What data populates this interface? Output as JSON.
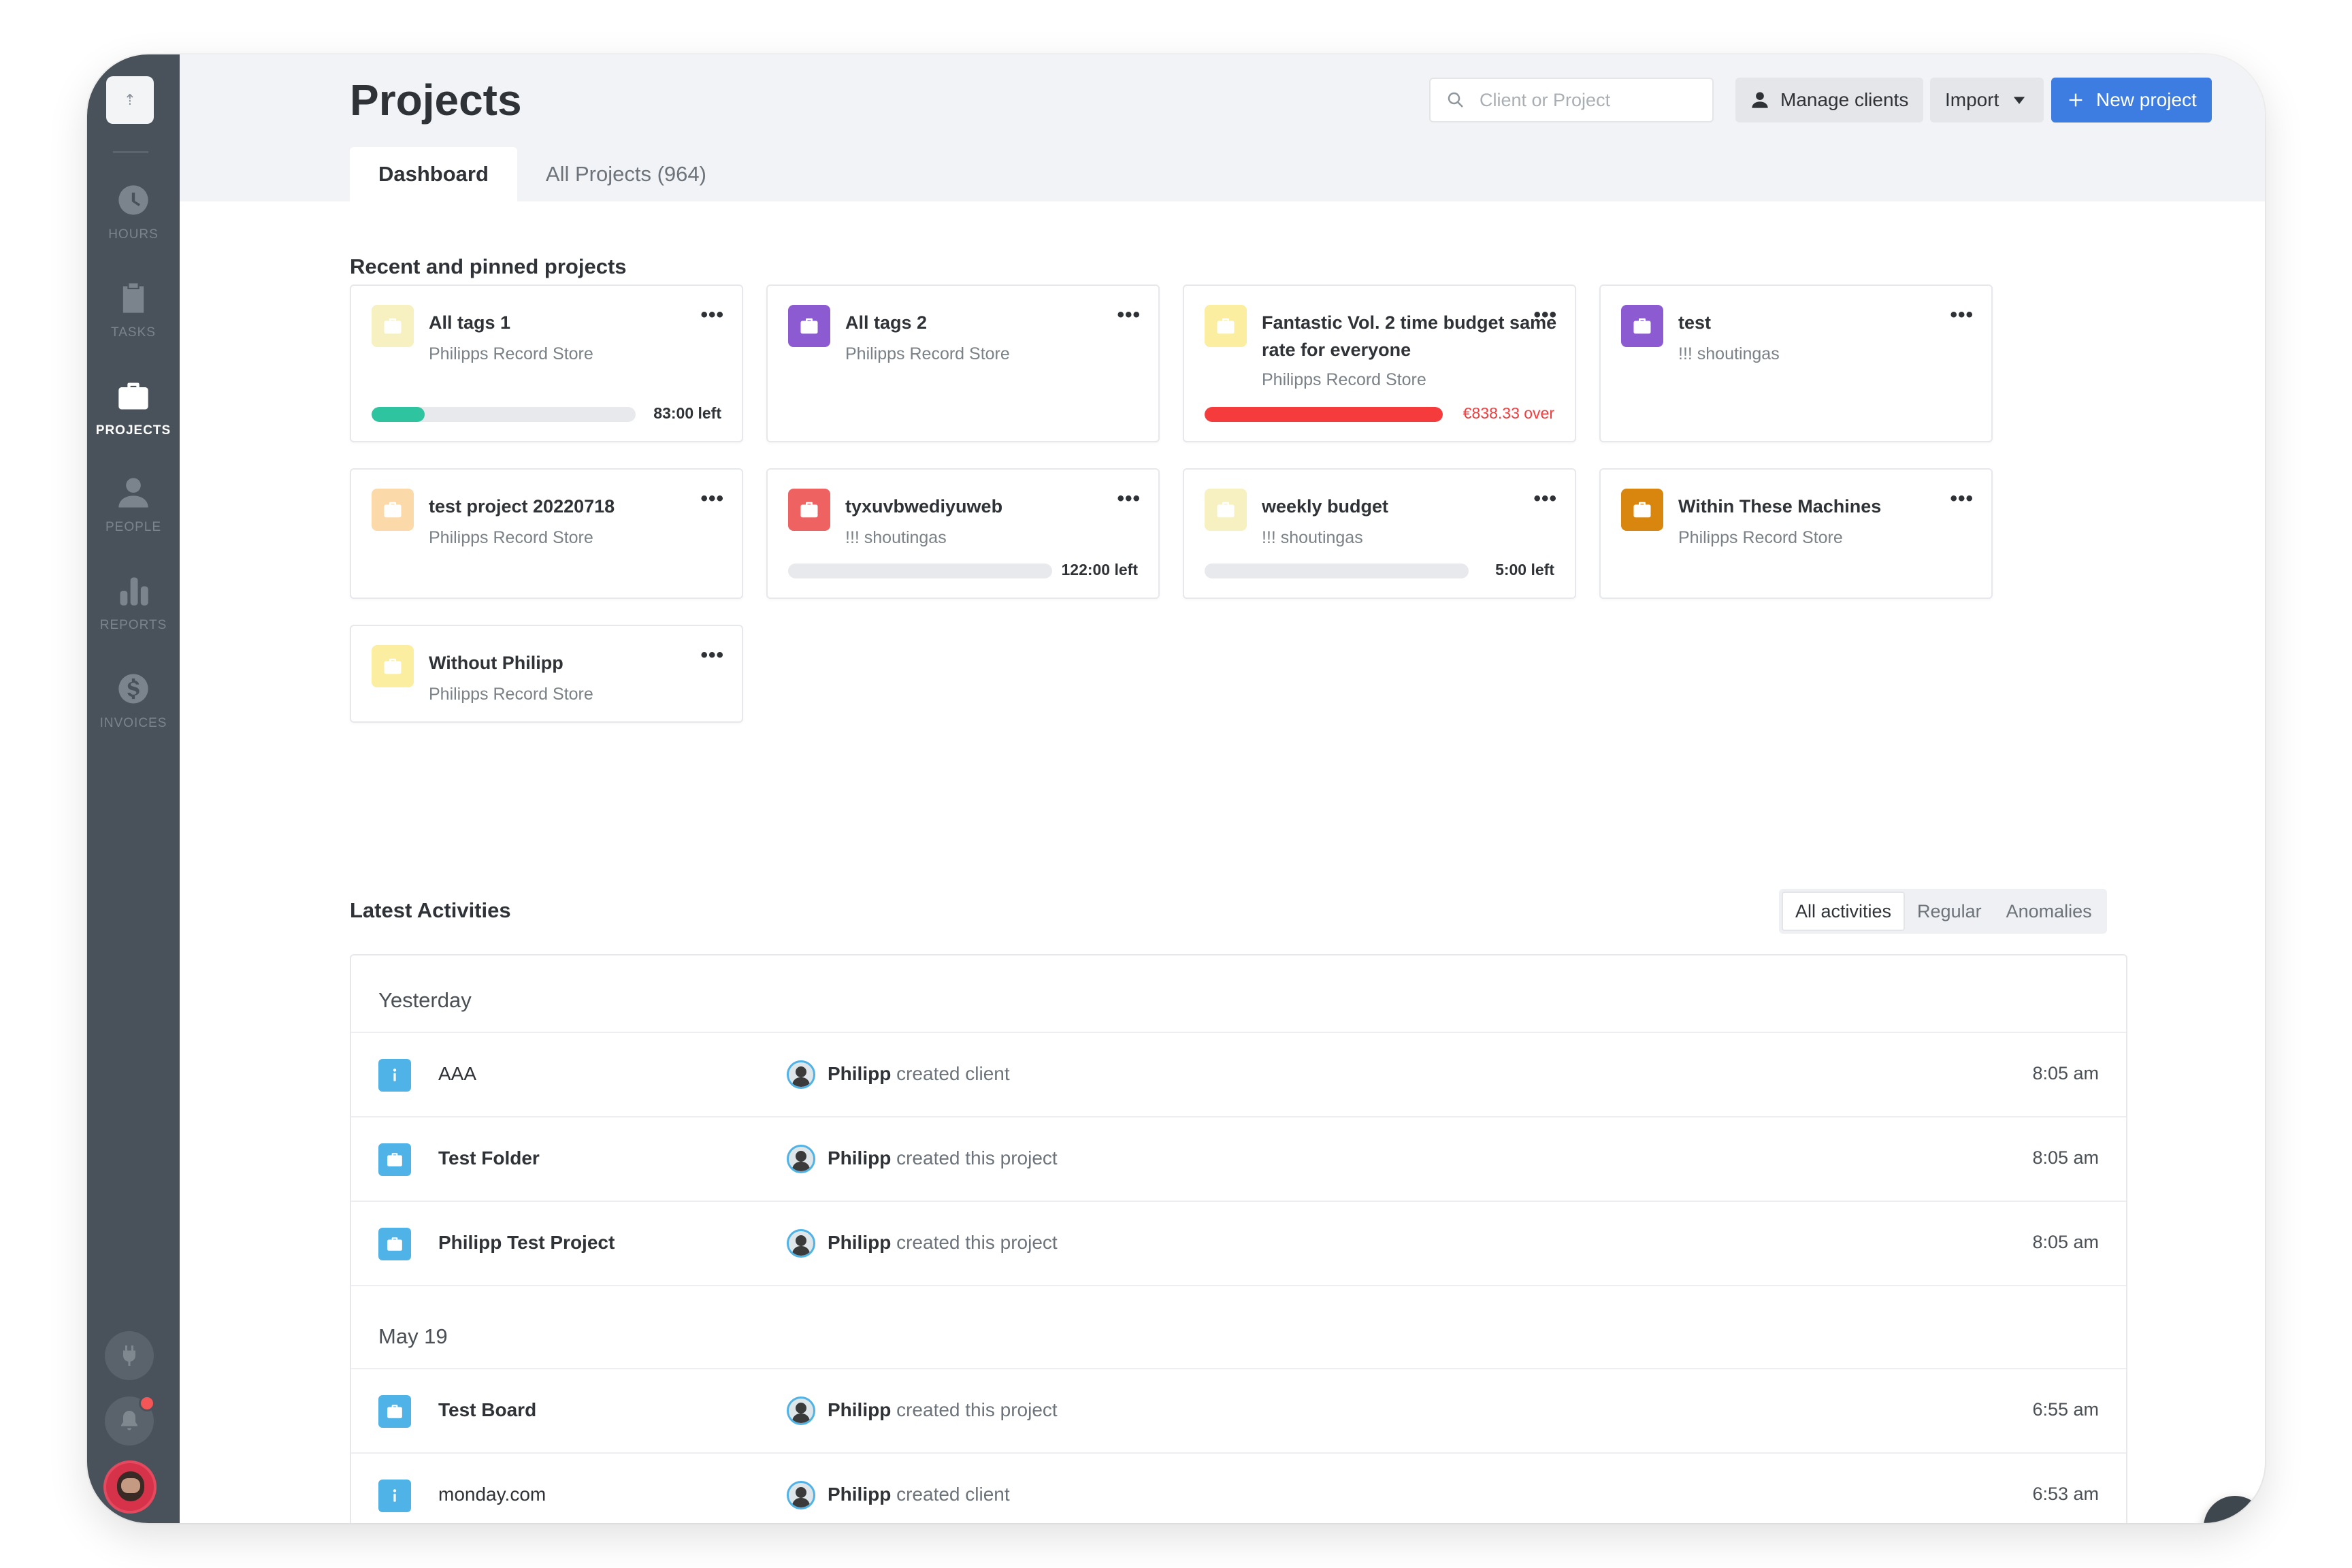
{
  "sidebar": {
    "nav": [
      {
        "id": "hours",
        "label": "HOURS",
        "icon": "clock-icon"
      },
      {
        "id": "tasks",
        "label": "TASKS",
        "icon": "clipboard-check-icon"
      },
      {
        "id": "projects",
        "label": "PROJECTS",
        "icon": "briefcase-icon",
        "active": true
      },
      {
        "id": "people",
        "label": "PEOPLE",
        "icon": "person-icon"
      },
      {
        "id": "reports",
        "label": "REPORTS",
        "icon": "bar-chart-icon"
      },
      {
        "id": "invoices",
        "label": "INVOICES",
        "icon": "dollar-icon"
      }
    ]
  },
  "header": {
    "title": "Projects",
    "search_placeholder": "Client or Project",
    "manage_clients_label": "Manage clients",
    "import_label": "Import",
    "new_project_label": "New project",
    "tabs": [
      {
        "label": "Dashboard",
        "active": true
      },
      {
        "label": "All Projects (964)",
        "active": false
      }
    ]
  },
  "recent": {
    "title": "Recent and pinned projects",
    "cards": [
      {
        "title": "All tags 1",
        "client": "Philipps Record Store",
        "color": "#f7f0c0",
        "budget_fraction": 0.2,
        "bar_color": "#2ec4a0",
        "budget_text": "83:00 left"
      },
      {
        "title": "All tags 2",
        "client": "Philipps Record Store",
        "color": "#8d5bd1"
      },
      {
        "title": "Fantastic Vol. 2 time budget same rate for everyone",
        "client": "Philipps Record Store",
        "color": "#fbeea0",
        "budget_fraction": 1.0,
        "bar_color": "#f53b3b",
        "budget_text": "€838.33 over",
        "over": true
      },
      {
        "title": "test",
        "client": "!!! shoutingas",
        "color": "#8d5bd1"
      },
      {
        "title": "test project 20220718",
        "client": "Philipps Record Store",
        "color": "#fbd9a8"
      },
      {
        "title": "tyxuvbwediyuweb",
        "client": "!!! shoutingas",
        "color": "#ee6262",
        "budget_fraction": 0.0,
        "bar_color": "#2ec4a0",
        "budget_text": "122:00 left"
      },
      {
        "title": "weekly budget",
        "client": "!!! shoutingas",
        "color": "#f7f0c0",
        "budget_fraction": 0.0,
        "bar_color": "#2ec4a0",
        "budget_text": "5:00 left"
      },
      {
        "title": "Within These Machines",
        "client": "Philipps Record Store",
        "color": "#d9860f"
      },
      {
        "title": "Without Philipp",
        "client": "Philipps Record Store",
        "color": "#fbeea0"
      }
    ]
  },
  "activities": {
    "title": "Latest Activities",
    "filters": [
      {
        "label": "All activities",
        "active": true
      },
      {
        "label": "Regular",
        "active": false
      },
      {
        "label": "Anomalies",
        "active": false
      }
    ],
    "groups": [
      {
        "title": "Yesterday",
        "rows": [
          {
            "name": "AAA",
            "type": "client",
            "bold": false,
            "user": "Philipp",
            "action": "created client",
            "time": "8:05 am"
          },
          {
            "name": "Test Folder",
            "type": "project",
            "bold": true,
            "user": "Philipp",
            "action": "created this project",
            "time": "8:05 am"
          },
          {
            "name": "Philipp Test Project",
            "type": "project",
            "bold": true,
            "user": "Philipp",
            "action": "created this project",
            "time": "8:05 am"
          }
        ]
      },
      {
        "title": "May 19",
        "rows": [
          {
            "name": "Test Board",
            "type": "project",
            "bold": true,
            "user": "Philipp",
            "action": "created this project",
            "time": "6:55 am"
          },
          {
            "name": "monday.com",
            "type": "client",
            "bold": false,
            "user": "Philipp",
            "action": "created client",
            "time": "6:53 am"
          }
        ]
      }
    ]
  },
  "help_label": "?"
}
